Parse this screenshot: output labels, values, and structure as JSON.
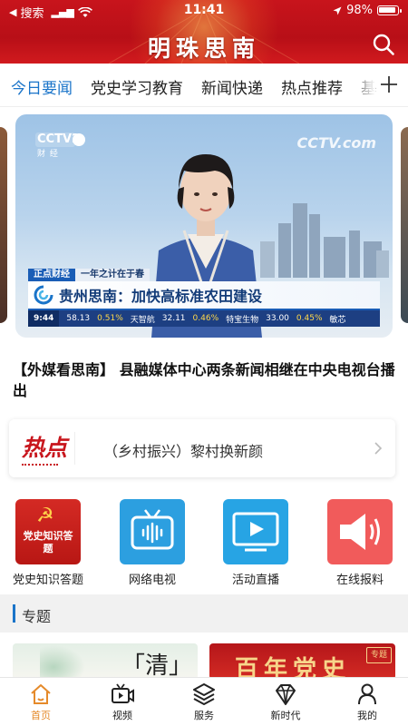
{
  "status_bar": {
    "back_label": "搜索",
    "time": "11:41",
    "battery": "98%"
  },
  "header": {
    "title": "明珠思南"
  },
  "tabs": [
    {
      "label": "今日要闻",
      "active": true
    },
    {
      "label": "党史学习教育",
      "active": false
    },
    {
      "label": "新闻快递",
      "active": false
    },
    {
      "label": "热点推荐",
      "active": false
    },
    {
      "label": "基",
      "active": false
    }
  ],
  "banner": {
    "channel": "CCTV2",
    "channel_sub": "财 经",
    "watermark": "CCTV.com",
    "program_tag": "正点财经",
    "program_slogan": "一年之计在于春",
    "caption": "贵州思南：加快高标准农田建设",
    "ticker": {
      "clock": "9:44",
      "items": [
        "58.13",
        "0.51%",
        "天智航",
        "32.11",
        "0.46%",
        "特宝生物",
        "33.00",
        "0.45%",
        "敏芯"
      ]
    }
  },
  "headline": "【外媒看思南】 县融媒体中心两条新闻相继在中央电视台播出",
  "hot": {
    "logo": "热点",
    "text": "（乡村振兴）黎村换新颜"
  },
  "quick_links": [
    {
      "label": "党史知识答题",
      "icon": "party-quiz-icon",
      "badge": "党史知识答题"
    },
    {
      "label": "网络电视",
      "icon": "tv-icon"
    },
    {
      "label": "活动直播",
      "icon": "live-play-icon"
    },
    {
      "label": "在线报料",
      "icon": "megaphone-icon"
    }
  ],
  "section": {
    "title": "专题"
  },
  "topics": [
    {
      "text": "「清」"
    },
    {
      "text": "百年党史",
      "stamp": "专题"
    }
  ],
  "tabbar": [
    {
      "label": "首页",
      "icon": "home-icon",
      "active": true
    },
    {
      "label": "视频",
      "icon": "video-icon",
      "active": false
    },
    {
      "label": "服务",
      "icon": "layers-icon",
      "active": false
    },
    {
      "label": "新时代",
      "icon": "diamond-icon",
      "active": false
    },
    {
      "label": "我的",
      "icon": "user-icon",
      "active": false
    }
  ],
  "colors": {
    "brand_red": "#c8141c",
    "accent_blue": "#1a74c9",
    "tab_active": "#e58a2a"
  }
}
